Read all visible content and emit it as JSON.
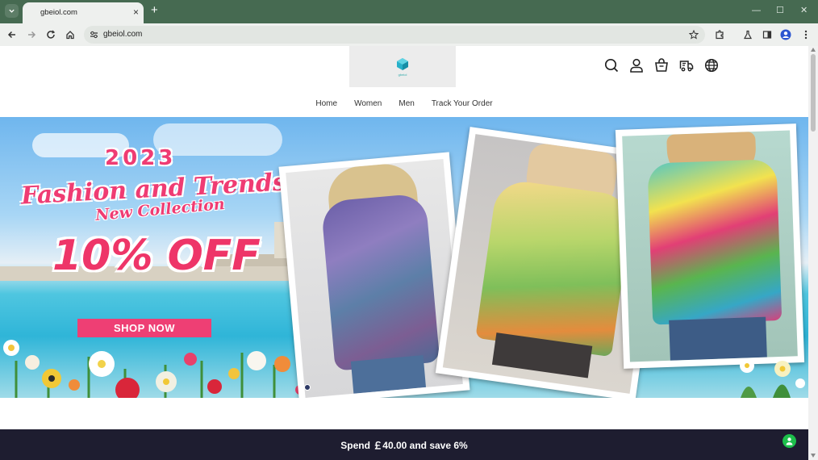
{
  "browser": {
    "tab_title": "gbeiol.com",
    "url": "gbeiol.com",
    "new_tab_symbol": "+",
    "close_symbol": "×",
    "window_controls": {
      "minimize": "—",
      "maximize": "☐",
      "close": "✕"
    }
  },
  "site": {
    "logo_text": "gbeiol",
    "header_icons": [
      "search-icon",
      "account-icon",
      "cart-icon",
      "track-order-icon",
      "language-globe-icon"
    ],
    "nav": [
      "Home",
      "Women",
      "Men",
      "Track Your Order"
    ]
  },
  "banner": {
    "year": "2023",
    "headline": "Fashion and Trends",
    "subheadline": "New Collection",
    "discount": "10% OFF",
    "cta": "SHOP NOW",
    "slides": 1,
    "colors": {
      "accent_pink": "#ee3f74"
    }
  },
  "promo": {
    "text": "Spend ￡40.00 and save 6%"
  },
  "colors": {
    "browser_chrome": "#476a52",
    "promo_bg": "#1e1d30",
    "chat_green": "#1dbf4b"
  }
}
